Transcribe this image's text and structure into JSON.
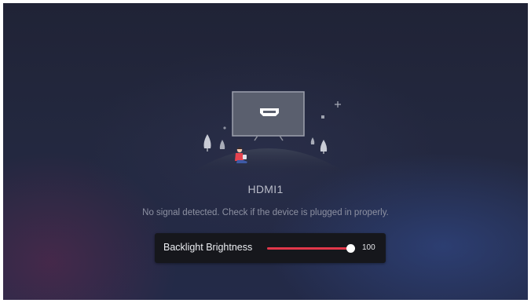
{
  "source": {
    "title": "HDMI1",
    "message": "No signal detected. Check if the device is plugged in properly.",
    "icon": "hdmi-port-icon"
  },
  "brightness": {
    "label": "Backlight Brightness",
    "value": "100",
    "level_percent": 100,
    "fill_color": "#e2374a"
  }
}
